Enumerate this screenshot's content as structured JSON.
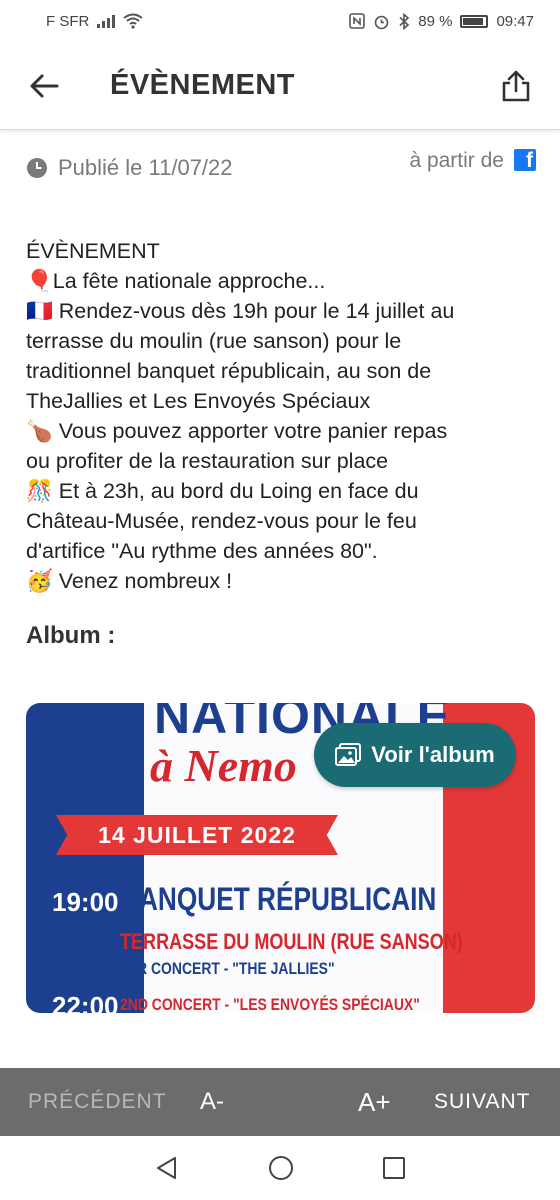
{
  "status_bar": {
    "carrier": "F SFR",
    "battery": "89 %",
    "time": "09:47"
  },
  "app_bar": {
    "title": "ÉVÈNEMENT",
    "back_icon": "arrow-left-icon",
    "share_icon": "share-icon"
  },
  "meta": {
    "published": "Publié le 11/07/22",
    "source_prefix": "à partir de",
    "source_icon": "facebook-icon"
  },
  "article": {
    "lines": [
      {
        "emoji": "",
        "text": "ÉVÈNEMENT"
      },
      {
        "emoji": "🎈",
        "text": "La fête nationale approche..."
      },
      {
        "emoji": "🇫🇷",
        "text": " Rendez-vous dès 19h pour le 14 juillet au"
      },
      {
        "emoji": "",
        "text": "terrasse du moulin (rue sanson) pour le"
      },
      {
        "emoji": "",
        "text": "traditionnel banquet républicain, au son de"
      },
      {
        "emoji": "",
        "text": "TheJallies et Les Envoyés Spéciaux"
      },
      {
        "emoji": "🍗",
        "text": " Vous pouvez apporter votre panier repas"
      },
      {
        "emoji": "",
        "text": "ou profiter de la restauration sur place"
      },
      {
        "emoji": "🎊",
        "text": " Et à 23h, au bord du Loing en face du"
      },
      {
        "emoji": "",
        "text": "Château-Musée, rendez-vous pour le feu"
      },
      {
        "emoji": "",
        "text": "d'artifice \"Au rythme des années 80\"."
      },
      {
        "emoji": "🥳",
        "text": " Venez nombreux !"
      }
    ]
  },
  "album": {
    "title": "Album :",
    "button_label": "Voir l'album",
    "button_icon": "gallery-icon",
    "poster": {
      "headline": "NATIONALE",
      "subline": "à Nemo",
      "date": "14 JUILLET 2022",
      "time1": "19:00",
      "banquet": "BANQUET RÉPUBLICAIN",
      "venue": "TERRASSE DU MOULIN (RUE SANSON)",
      "concert1": "1ER CONCERT - \"THE JALLIES\"",
      "time2": "22:00",
      "concert2": "2ND CONCERT - \"LES ENVOYÉS SPÉCIAUX\""
    }
  },
  "toolbar": {
    "prev": "PRÉCÉDENT",
    "font_decrease": "A-",
    "font_increase": "A+",
    "next": "SUIVANT"
  },
  "nav": {
    "back": "triangle-back-icon",
    "home": "circle-home-icon",
    "recents": "square-recents-icon"
  }
}
